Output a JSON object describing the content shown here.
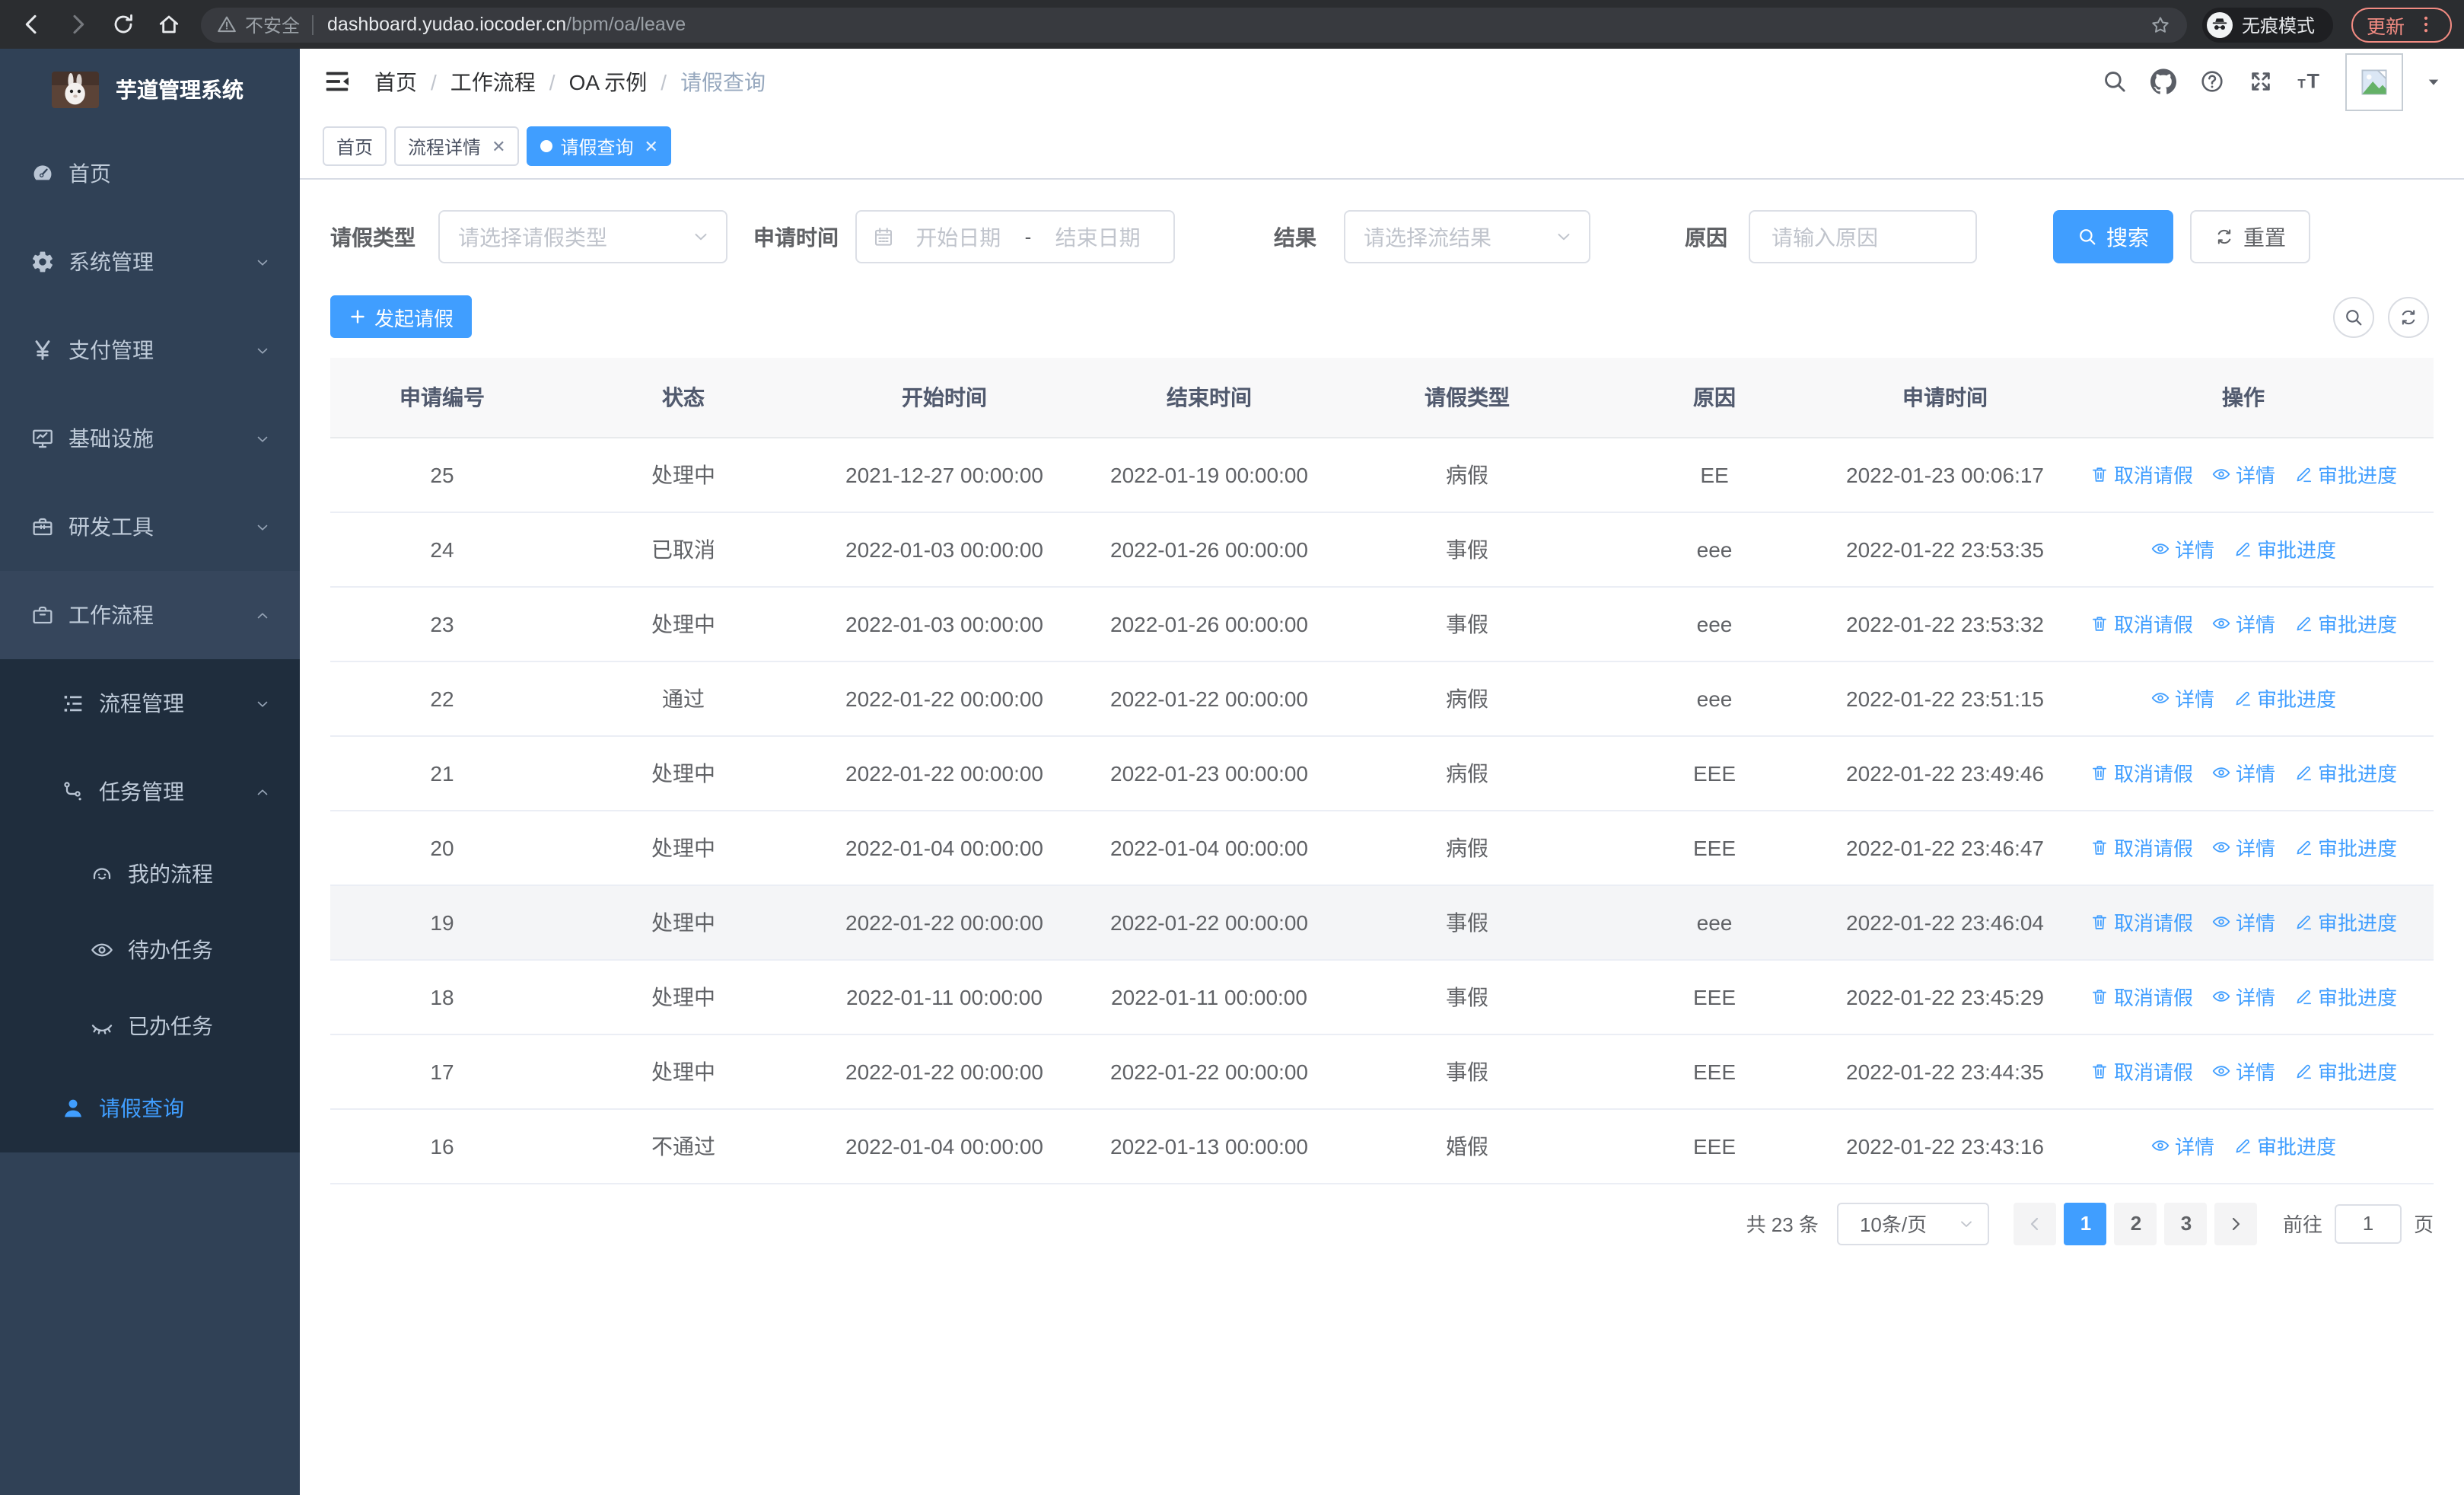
{
  "browser": {
    "security_label": "不安全",
    "url_host": "dashboard.yudao.iocoder.cn",
    "url_path": "/bpm/oa/leave",
    "incognito_label": "无痕模式",
    "update_label": "更新"
  },
  "colors": {
    "accent": "#409eff",
    "sidebar_bg": "#304156",
    "sidebar_submenu_bg": "#1f2d3d",
    "table_header_bg": "#f8f8f9",
    "update_pill": "#f28b82"
  },
  "sidebar": {
    "title": "芋道管理系统",
    "items": [
      {
        "name": "home",
        "label": "首页",
        "icon": "dashboard-icon",
        "level": 1
      },
      {
        "name": "system-management",
        "label": "系统管理",
        "icon": "gear-icon",
        "level": 1,
        "arrow": "down"
      },
      {
        "name": "payment-management",
        "label": "支付管理",
        "icon": "yen-icon",
        "level": 1,
        "arrow": "down"
      },
      {
        "name": "infrastructure",
        "label": "基础设施",
        "icon": "monitor-icon",
        "level": 1,
        "arrow": "down"
      },
      {
        "name": "dev-tools",
        "label": "研发工具",
        "icon": "toolbox-icon",
        "level": 1,
        "arrow": "down"
      },
      {
        "name": "workflow",
        "label": "工作流程",
        "icon": "briefcase-icon",
        "level": 1,
        "arrow": "up",
        "lift": true
      },
      {
        "name": "process-management",
        "label": "流程管理",
        "icon": "tree-icon",
        "level": 2,
        "arrow": "down",
        "dark": true
      },
      {
        "name": "task-management",
        "label": "任务管理",
        "icon": "flow-icon",
        "level": 2,
        "arrow": "up",
        "dark": true
      },
      {
        "name": "my-process",
        "label": "我的流程",
        "icon": "face-icon",
        "level": 3,
        "dark": true
      },
      {
        "name": "todo-tasks",
        "label": "待办任务",
        "icon": "eye-icon",
        "level": 3,
        "dark": true
      },
      {
        "name": "done-tasks",
        "label": "已办任务",
        "icon": "eye-closed-icon",
        "level": 3,
        "dark": true
      },
      {
        "name": "leave-query",
        "label": "请假查询",
        "icon": "user-icon",
        "level": 2,
        "dark": true,
        "active": true
      }
    ]
  },
  "navbar": {
    "breadcrumb": [
      "首页",
      "工作流程",
      "OA 示例",
      "请假查询"
    ]
  },
  "tabs": [
    {
      "label": "首页",
      "closable": false,
      "active": false
    },
    {
      "label": "流程详情",
      "closable": true,
      "active": false
    },
    {
      "label": "请假查询",
      "closable": true,
      "active": true
    }
  ],
  "filters": {
    "leave_type_label": "请假类型",
    "leave_type_placeholder": "请选择请假类型",
    "apply_time_label": "申请时间",
    "date_start_placeholder": "开始日期",
    "date_separator": "-",
    "date_end_placeholder": "结束日期",
    "result_label": "结果",
    "result_placeholder": "请选择流结果",
    "reason_label": "原因",
    "reason_placeholder": "请输入原因",
    "search_label": "搜索",
    "reset_label": "重置"
  },
  "toolbar": {
    "create_label": "发起请假"
  },
  "table": {
    "columns": [
      "申请编号",
      "状态",
      "开始时间",
      "结束时间",
      "请假类型",
      "原因",
      "申请时间",
      "操作"
    ],
    "action_labels": {
      "cancel": "取消请假",
      "detail": "详情",
      "progress": "审批进度"
    },
    "rows": [
      {
        "id": "25",
        "status": "处理中",
        "start": "2021-12-27 00:00:00",
        "end": "2022-01-19 00:00:00",
        "type": "病假",
        "reason": "EE",
        "apply": "2022-01-23 00:06:17",
        "actions": [
          "cancel",
          "detail",
          "progress"
        ],
        "highlight": false
      },
      {
        "id": "24",
        "status": "已取消",
        "start": "2022-01-03 00:00:00",
        "end": "2022-01-26 00:00:00",
        "type": "事假",
        "reason": "eee",
        "apply": "2022-01-22 23:53:35",
        "actions": [
          "detail",
          "progress"
        ],
        "highlight": false
      },
      {
        "id": "23",
        "status": "处理中",
        "start": "2022-01-03 00:00:00",
        "end": "2022-01-26 00:00:00",
        "type": "事假",
        "reason": "eee",
        "apply": "2022-01-22 23:53:32",
        "actions": [
          "cancel",
          "detail",
          "progress"
        ],
        "highlight": false
      },
      {
        "id": "22",
        "status": "通过",
        "start": "2022-01-22 00:00:00",
        "end": "2022-01-22 00:00:00",
        "type": "病假",
        "reason": "eee",
        "apply": "2022-01-22 23:51:15",
        "actions": [
          "detail",
          "progress"
        ],
        "highlight": false
      },
      {
        "id": "21",
        "status": "处理中",
        "start": "2022-01-22 00:00:00",
        "end": "2022-01-23 00:00:00",
        "type": "病假",
        "reason": "EEE",
        "apply": "2022-01-22 23:49:46",
        "actions": [
          "cancel",
          "detail",
          "progress"
        ],
        "highlight": false
      },
      {
        "id": "20",
        "status": "处理中",
        "start": "2022-01-04 00:00:00",
        "end": "2022-01-04 00:00:00",
        "type": "病假",
        "reason": "EEE",
        "apply": "2022-01-22 23:46:47",
        "actions": [
          "cancel",
          "detail",
          "progress"
        ],
        "highlight": false
      },
      {
        "id": "19",
        "status": "处理中",
        "start": "2022-01-22 00:00:00",
        "end": "2022-01-22 00:00:00",
        "type": "事假",
        "reason": "eee",
        "apply": "2022-01-22 23:46:04",
        "actions": [
          "cancel",
          "detail",
          "progress"
        ],
        "highlight": true
      },
      {
        "id": "18",
        "status": "处理中",
        "start": "2022-01-11 00:00:00",
        "end": "2022-01-11 00:00:00",
        "type": "事假",
        "reason": "EEE",
        "apply": "2022-01-22 23:45:29",
        "actions": [
          "cancel",
          "detail",
          "progress"
        ],
        "highlight": false
      },
      {
        "id": "17",
        "status": "处理中",
        "start": "2022-01-22 00:00:00",
        "end": "2022-01-22 00:00:00",
        "type": "事假",
        "reason": "EEE",
        "apply": "2022-01-22 23:44:35",
        "actions": [
          "cancel",
          "detail",
          "progress"
        ],
        "highlight": false
      },
      {
        "id": "16",
        "status": "不通过",
        "start": "2022-01-04 00:00:00",
        "end": "2022-01-13 00:00:00",
        "type": "婚假",
        "reason": "EEE",
        "apply": "2022-01-22 23:43:16",
        "actions": [
          "detail",
          "progress"
        ],
        "highlight": false
      }
    ]
  },
  "pagination": {
    "total_label": "共 23 条",
    "page_size_label": "10条/页",
    "pages": [
      "1",
      "2",
      "3"
    ],
    "active_page": "1",
    "goto_label": "前往",
    "goto_value": "1",
    "page_unit_label": "页"
  }
}
